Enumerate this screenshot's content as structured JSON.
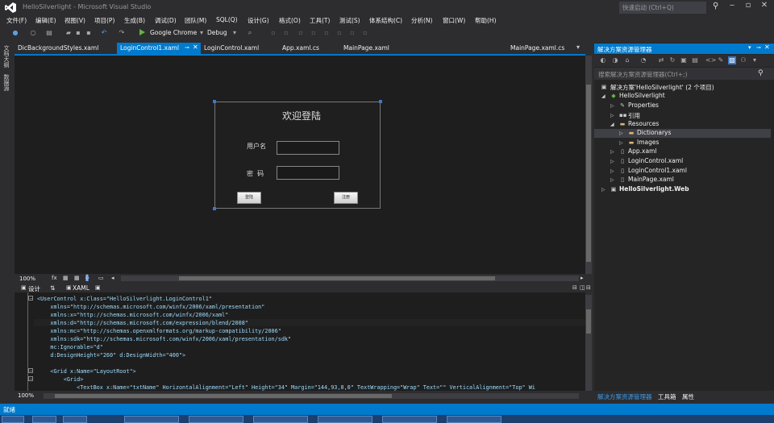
{
  "window": {
    "title": "HelloSilverlight - Microsoft Visual Studio",
    "quick_launch_placeholder": "快速启动 (Ctrl+Q)"
  },
  "menu": [
    "文件(F)",
    "编辑(E)",
    "视图(V)",
    "项目(P)",
    "生成(B)",
    "调试(D)",
    "团队(M)",
    "SQL(Q)",
    "设计(G)",
    "格式(O)",
    "工具(T)",
    "测试(S)",
    "体系结构(C)",
    "分析(N)",
    "窗口(W)",
    "帮助(H)"
  ],
  "toolbar": {
    "run_target": "Google Chrome",
    "configuration": "Debug"
  },
  "left_strip": [
    "文档大纲",
    "数据源"
  ],
  "doc_tabs": [
    {
      "label": "DicBackgroundStyles.xaml",
      "active": false
    },
    {
      "label": "LoginControl1.xaml",
      "active": true
    },
    {
      "label": "LoginControl.xaml",
      "active": false
    },
    {
      "label": "App.xaml.cs",
      "active": false
    },
    {
      "label": "MainPage.xaml",
      "active": false
    },
    {
      "label": "MainPage.xaml.cs",
      "active": false
    }
  ],
  "designer": {
    "login_title": "欢迎登陆",
    "user_label": "用户名",
    "password_label": "密  码",
    "login_button": "登陆",
    "register_button": "注册",
    "zoom": "100%"
  },
  "split": {
    "design_tab": "设计",
    "swap": "⇅",
    "xaml_tab": "XAML"
  },
  "code": {
    "zoom": "100%",
    "lines": [
      "<UserControl x:Class=\"HelloSilverlight.LoginControl1\"",
      "    xmlns=\"http://schemas.microsoft.com/winfx/2006/xaml/presentation\"",
      "    xmlns:x=\"http://schemas.microsoft.com/winfx/2006/xaml\"",
      "    xmlns:d=\"http://schemas.microsoft.com/expression/blend/2008\"",
      "    xmlns:mc=\"http://schemas.openxmlformats.org/markup-compatibility/2006\"",
      "    xmlns:sdk=\"http://schemas.microsoft.com/winfx/2006/xaml/presentation/sdk\"",
      "    mc:Ignorable=\"d\"",
      "    d:DesignHeight=\"260\" d:DesignWidth=\"400\">",
      "",
      "    <Grid x:Name=\"LayoutRoot\">",
      "        <Grid>",
      "            <TextBox x:Name=\"txtName\" HorizontalAlignment=\"Left\" Height=\"34\" Margin=\"144,93,0,0\" TextWrapping=\"Wrap\" Text=\"\" VerticalAlignment=\"Top\" Wi"
    ]
  },
  "solution_explorer": {
    "title": "解决方案资源管理器",
    "search_placeholder": "搜索解决方案资源管理器(Ctrl+;)",
    "items": [
      {
        "label": "解决方案'HelloSilverlight' (2 个项目)",
        "icon": "solution-icon"
      },
      {
        "label": "HelloSilverlight",
        "icon": "project-icon"
      },
      {
        "label": "Properties",
        "icon": "wrench-icon"
      },
      {
        "label": "引用",
        "icon": "references-icon"
      },
      {
        "label": "Resources",
        "icon": "folder-icon"
      },
      {
        "label": "Dictionarys",
        "icon": "folder-icon"
      },
      {
        "label": "Images",
        "icon": "folder-icon"
      },
      {
        "label": "App.xaml",
        "icon": "file-icon"
      },
      {
        "label": "LoginControl.xaml",
        "icon": "file-icon"
      },
      {
        "label": "LoginControl1.xaml",
        "icon": "file-icon"
      },
      {
        "label": "MainPage.xaml",
        "icon": "file-icon"
      },
      {
        "label": "HelloSilverlight.Web",
        "icon": "web-project-icon"
      }
    ],
    "bottom_tabs": [
      "解决方案资源管理器",
      "工具箱",
      "属性"
    ]
  },
  "status": {
    "text": "就绪"
  },
  "colors": {
    "accent": "#007acc",
    "background": "#2d2d30",
    "editor": "#1e1e1e"
  }
}
